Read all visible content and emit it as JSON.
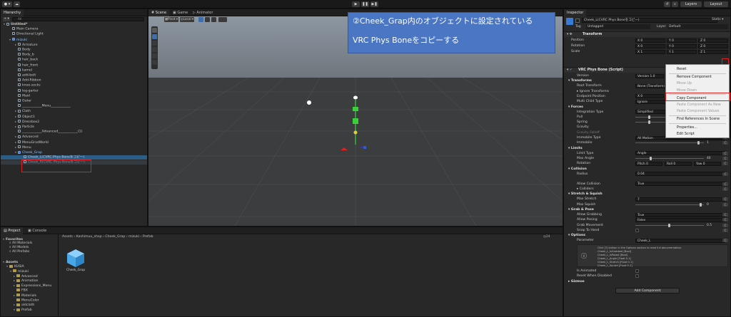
{
  "toolbar": {
    "account": "● ▾",
    "cloud": "☁",
    "play": "▶",
    "pause": "❚❚",
    "step": "▶❚",
    "layers": "Layers",
    "layout": "Layout"
  },
  "hierarchy": {
    "tab": "Hierarchy",
    "search_placeholder": "All",
    "items": [
      {
        "label": "Untitled*",
        "indent": 0,
        "arrow": "▾",
        "bold": true
      },
      {
        "label": "Main Camera",
        "indent": 1
      },
      {
        "label": "Directional Light",
        "indent": 1
      },
      {
        "label": "mizuki",
        "indent": 1,
        "arrow": "▾",
        "blue": true
      },
      {
        "label": "Armature",
        "indent": 2,
        "arrow": "▸"
      },
      {
        "label": "Body",
        "indent": 2
      },
      {
        "label": "Body_b",
        "indent": 2
      },
      {
        "label": "hair_back",
        "indent": 2
      },
      {
        "label": "hair_front",
        "indent": 2
      },
      {
        "label": "kamel",
        "indent": 2
      },
      {
        "label": "add-belt",
        "indent": 2
      },
      {
        "label": "Add-Ribbon",
        "indent": 2
      },
      {
        "label": "knee-socks",
        "indent": 2
      },
      {
        "label": "leg-garter",
        "indent": 2
      },
      {
        "label": "Maid",
        "indent": 2
      },
      {
        "label": "Outer",
        "indent": 2
      },
      {
        "label": "____________Menu____________",
        "indent": 2
      },
      {
        "label": "Cloth",
        "indent": 2,
        "arrow": "▸"
      },
      {
        "label": "Object1",
        "indent": 2,
        "arrow": "▸"
      },
      {
        "label": "Dressbox2",
        "indent": 2,
        "arrow": "▸"
      },
      {
        "label": "Particle",
        "indent": 2,
        "arrow": "▸"
      },
      {
        "label": "____________Advanced____________(1)",
        "indent": 2
      },
      {
        "label": "Advanced",
        "indent": 2,
        "arrow": "▸"
      },
      {
        "label": "MenuGradWorld",
        "indent": 2,
        "arrow": "▸"
      },
      {
        "label": "Menu",
        "indent": 2,
        "arrow": "▸"
      },
      {
        "label": "Cheek_Grap",
        "indent": 2,
        "arrow": "▾",
        "blue": true
      },
      {
        "label": "Cheek_L(CVRC Phys Boneをコピー)",
        "indent": 3,
        "sel": true
      },
      {
        "label": "Cheek_R(CVRC Phys Boneをコピー)",
        "indent": 3,
        "dim": true
      }
    ]
  },
  "scene": {
    "tabs": [
      "# Scene",
      "▣ Game",
      "▷ Animator"
    ],
    "pivot": "▦Pivot ▾",
    "local": "◎Local ▾",
    "persp": "← Persp"
  },
  "annotation": {
    "line1": "②Cheek_Grap内のオブジェクトに設定されている",
    "line2": "VRC Phys Boneをコピーする"
  },
  "inspector": {
    "tab": "Inspector",
    "object_name": "Cheek_L(CVRC Phys Boneをコピー)",
    "static": "Static ▾",
    "tag_label": "Tag",
    "tag_value": "Untagged",
    "layer_label": "Layer",
    "layer_value": "Default",
    "transform_title": "Transform",
    "position_label": "Position",
    "rotation_label": "Rotation",
    "scale_label": "Scale",
    "position": [
      "X  0",
      "Y  0",
      "Z  0"
    ],
    "rotation": [
      "X  0",
      "Y  0",
      "Z  0"
    ],
    "scale": [
      "X  1",
      "Y  1",
      "Z  1"
    ],
    "physbone_title": "VRC Phys Bone (Script)",
    "version_label": "Version",
    "version_value": "Version 1.0",
    "transforms_section": "Transforms",
    "root_transform": "Root Transform",
    "root_value": "None (Transform)",
    "ignore_transforms": "▸ Ignore Transforms",
    "endpoint_position": "Endpoint Position",
    "endpoint_value": "X  0",
    "multi_child": "Multi Child Type",
    "multi_child_value": "Ignore",
    "forces_section": "Forces",
    "integration_type": "Integration Type",
    "integration_value": "Simplified",
    "pull": "Pull",
    "spring": "Spring",
    "gravity": "Gravity",
    "gravity_falloff": "Gravity Falloff",
    "immobile_type": "Immobile Type",
    "immobile_type_value": "All Motion",
    "immobile": "Immobile",
    "immobile_value": "1",
    "limits_section": "Limits",
    "limit_type": "Limit Type",
    "limit_type_value": "Angle",
    "max_angle": "Max Angle",
    "max_angle_value": "40",
    "rotation2": "Rotation",
    "pitch": "Pitch  0",
    "roll": "Roll  0",
    "yaw": "Yaw  0",
    "collision_section": "Collision",
    "radius": "Radius",
    "radius_value": "0.04",
    "allow_collision": "Allow Collision",
    "allow_collision_value": "True",
    "colliders": "▸ Colliders",
    "stretch_section": "Stretch & Squish",
    "max_stretch": "Max Stretch",
    "max_stretch_value": "7",
    "max_squish": "Max Squish",
    "max_squish_value": "0",
    "grab_section": "Grab & Pose",
    "allow_grabbing": "Allow Grabbing",
    "allow_grabbing_value": "True",
    "allow_posing": "Allow Posing",
    "allow_posing_value": "False",
    "grab_movement": "Grab Movement",
    "grab_movement_value": "0.5",
    "snap_to_hand": "Snap To Hand",
    "options_section": "Options",
    "parameter": "Parameter",
    "parameter_value": "Cheek_L",
    "info_lines": [
      "Click [?] button in the Options section to read full documentation.",
      "Cheek_L_IsGrabbed [Bool]",
      "Cheek_L_IsPosed [Bool]",
      "Cheek_L_Angle [Float 0-1]",
      "Cheek_L_Stretch [Float 0-1]",
      "Cheek_L_Squish [Float 0-1]"
    ],
    "is_animated": "Is Animated",
    "reset_when_disabled": "Reset When Disabled",
    "gizmos_section": "Gizmos",
    "add_component": "Add Component"
  },
  "context_menu": {
    "items": [
      {
        "label": "Reset",
        "disabled": false
      },
      {
        "label": "Remove Component",
        "disabled": false
      },
      {
        "label": "Move Up",
        "disabled": true
      },
      {
        "label": "Move Down",
        "disabled": true
      },
      {
        "label": "Copy Component",
        "disabled": false,
        "highlight": true
      },
      {
        "label": "Paste Component As New",
        "disabled": true
      },
      {
        "label": "Paste Component Values",
        "disabled": true
      },
      {
        "label": "Find References In Scene",
        "disabled": false
      },
      {
        "label": "Properties...",
        "disabled": false
      },
      {
        "label": "Edit Script",
        "disabled": false
      }
    ]
  },
  "project": {
    "tabs": [
      "▤ Project",
      "▣ Console"
    ],
    "breadcrumb": "Assets › Kashimuu_shop › Cheek_Grap › mizuki › Prefab",
    "count": "◎24",
    "favorites": "Favorites",
    "fav_items": [
      "All Materials",
      "All Models",
      "All Prefabs"
    ],
    "assets": "Assets",
    "tree": [
      {
        "label": "KUSIA",
        "indent": 1,
        "arrow": "▾"
      },
      {
        "label": "mizuki",
        "indent": 2,
        "arrow": "▾"
      },
      {
        "label": "Advanced",
        "indent": 3,
        "arrow": "▸"
      },
      {
        "label": "Animation",
        "indent": 3,
        "arrow": "▸"
      },
      {
        "label": "Expressions_Menu",
        "indent": 3,
        "arrow": "▸"
      },
      {
        "label": "FBX",
        "indent": 3
      },
      {
        "label": "Materials",
        "indent": 3,
        "arrow": "▸"
      },
      {
        "label": "MenuColor",
        "indent": 3
      },
      {
        "label": "oldcloth",
        "indent": 3,
        "arrow": "▸"
      },
      {
        "label": "Prefab",
        "indent": 3,
        "arrow": "▾"
      }
    ],
    "asset_name": "Cheek_Grap"
  }
}
